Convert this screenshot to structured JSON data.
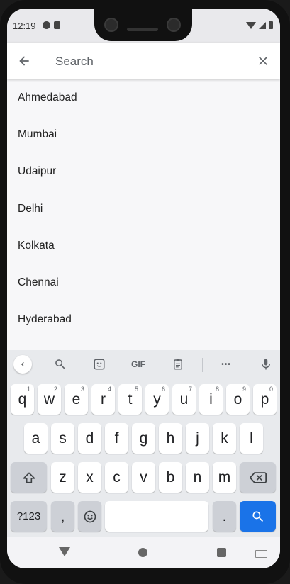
{
  "status": {
    "time": "12:19",
    "left_icons": [
      "sync-icon",
      "sd-card-icon"
    ],
    "right_icons": [
      "wifi-icon",
      "signal-icon",
      "battery-icon"
    ]
  },
  "search": {
    "placeholder": "Search",
    "value": "",
    "back_icon": "arrow-left-icon",
    "clear_icon": "close-icon"
  },
  "cities": [
    "Ahmedabad",
    "Mumbai",
    "Udaipur",
    "Delhi",
    "Kolkata",
    "Chennai",
    "Hyderabad"
  ],
  "keyboard": {
    "toolbar": {
      "gif_label": "GIF",
      "more_label": "•••",
      "icons": [
        "chevron-left-icon",
        "search-icon",
        "sticker-icon",
        "gif-icon",
        "clipboard-icon",
        "more-icon",
        "mic-icon"
      ]
    },
    "row1": [
      {
        "k": "q",
        "h": "1"
      },
      {
        "k": "w",
        "h": "2"
      },
      {
        "k": "e",
        "h": "3"
      },
      {
        "k": "r",
        "h": "4"
      },
      {
        "k": "t",
        "h": "5"
      },
      {
        "k": "y",
        "h": "6"
      },
      {
        "k": "u",
        "h": "7"
      },
      {
        "k": "i",
        "h": "8"
      },
      {
        "k": "o",
        "h": "9"
      },
      {
        "k": "p",
        "h": "0"
      }
    ],
    "row2": [
      "a",
      "s",
      "d",
      "f",
      "g",
      "h",
      "j",
      "k",
      "l"
    ],
    "row3": [
      "z",
      "x",
      "c",
      "v",
      "b",
      "n",
      "m"
    ],
    "symbols_label": "?123",
    "comma_label": ",",
    "period_label": ".",
    "space_label": ""
  },
  "colors": {
    "accent": "#1a73e8",
    "keyboard_bg": "#e8eaed",
    "function_key": "#cdd0d6"
  }
}
